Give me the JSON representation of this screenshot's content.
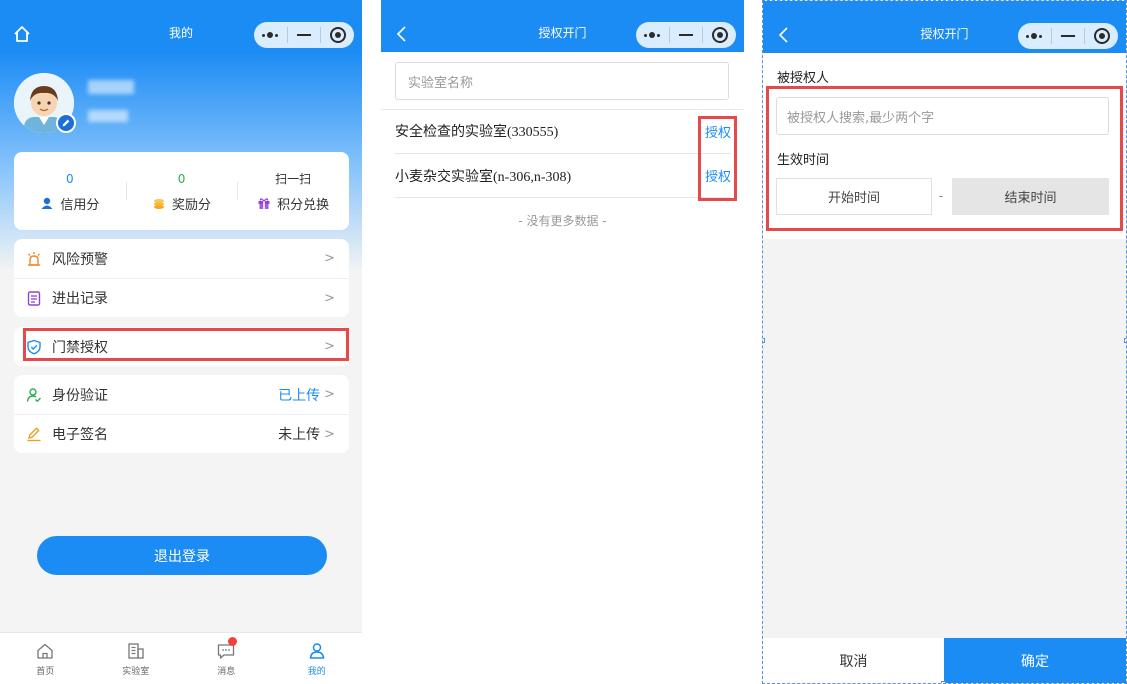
{
  "colors": {
    "primary": "#1c8cf5",
    "highlight_red": "#e5494a",
    "badge_red": "#f0413f"
  },
  "panel_mine": {
    "header": {
      "title": "我的",
      "left_icon": "home-icon"
    },
    "stats": [
      {
        "value": "0",
        "label": "信用分",
        "icon": "credit-icon",
        "value_color": "#1c8cf5"
      },
      {
        "value": "0",
        "label": "奖励分",
        "icon": "coins-icon",
        "value_color": "#2bb24c"
      },
      {
        "value": "扫一扫",
        "label": "积分兑换",
        "icon": "gift-icon",
        "value_color": "#333333"
      }
    ],
    "menu_group_1": [
      {
        "label": "风险预警",
        "icon": "alarm-icon"
      },
      {
        "label": "进出记录",
        "icon": "record-icon"
      }
    ],
    "menu_group_2": [
      {
        "label": "门禁授权",
        "icon": "shield-icon"
      }
    ],
    "menu_group_3": [
      {
        "label": "身份验证",
        "icon": "user-verify-icon",
        "value": "已上传",
        "value_color": "#1c8cf5"
      },
      {
        "label": "电子签名",
        "icon": "pen-icon",
        "value": "未上传",
        "value_color": "#333333"
      }
    ],
    "logout_label": "退出登录",
    "tabbar": [
      {
        "label": "首页",
        "icon": "home-tab-icon",
        "active": false
      },
      {
        "label": "实验室",
        "icon": "building-icon",
        "active": false
      },
      {
        "label": "消息",
        "icon": "message-icon",
        "active": false,
        "badge": true
      },
      {
        "label": "我的",
        "icon": "profile-icon",
        "active": true
      }
    ]
  },
  "panel_authlist": {
    "header": {
      "title": "授权开门",
      "left_icon": "back-icon"
    },
    "search_placeholder": "实验室名称",
    "labs": [
      {
        "name": "安全检查的实验室(330555)",
        "action": "授权"
      },
      {
        "name": "小麦杂交实验室(n-306,n-308)",
        "action": "授权"
      }
    ],
    "no_more": "- 没有更多数据 -"
  },
  "panel_authform": {
    "header": {
      "title": "授权开门",
      "left_icon": "back-icon"
    },
    "grantee_label": "被授权人",
    "grantee_placeholder": "被授权人搜索,最少两个字",
    "time_label": "生效时间",
    "start_placeholder": "开始时间",
    "separator": "-",
    "end_placeholder": "结束时间",
    "cancel_label": "取消",
    "ok_label": "确定"
  }
}
